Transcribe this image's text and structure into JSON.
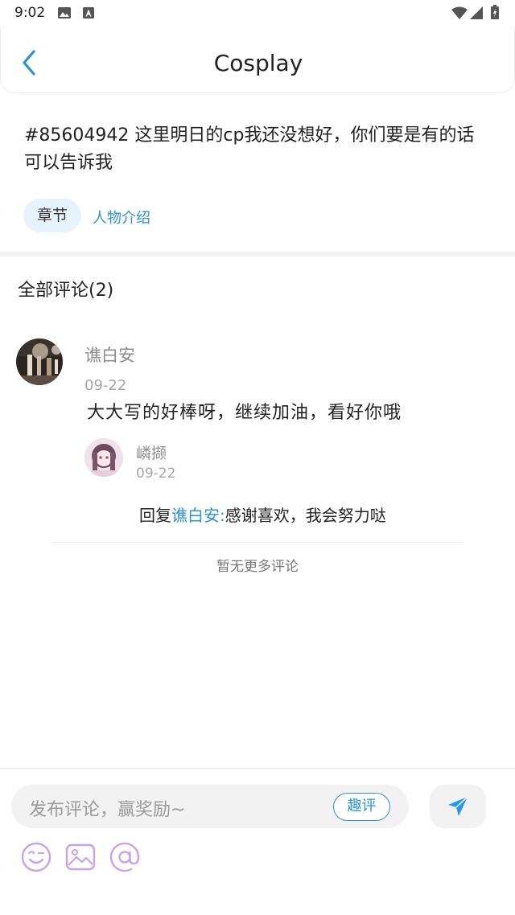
{
  "status_bar": {
    "time": "9:02"
  },
  "header": {
    "title": "Cosplay"
  },
  "post": {
    "text": "#85604942 这里明日的cp我还没想好，你们要是有的话可以告诉我",
    "chip_label": "章节",
    "link_label": "人物介绍"
  },
  "comments": {
    "title": "全部评论(2)",
    "items": [
      {
        "author": "谯白安",
        "date": "09-22",
        "text": "大大写的好棒呀，继续加油，看好你哦",
        "reply": {
          "author": "嶙撷",
          "date": "09-22",
          "prefix": "回复",
          "mention": "谯白安:",
          "text": "感谢喜欢，我会努力哒"
        }
      }
    ],
    "no_more": "暂无更多评论"
  },
  "composer": {
    "placeholder": "发布评论，赢奖励~",
    "qp_label": "趣评",
    "icons": [
      "emoji-icon",
      "image-icon",
      "at-icon"
    ]
  },
  "colors": {
    "accent": "#2b92d8",
    "icon_purple": "#c8a2ef",
    "send_blue": "#2196f3"
  }
}
